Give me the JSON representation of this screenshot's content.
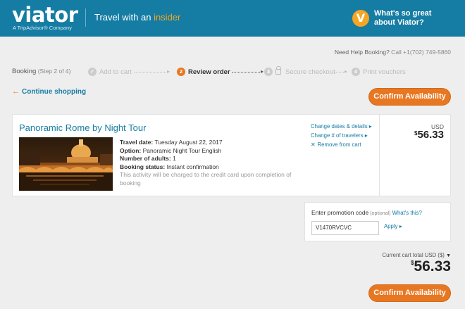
{
  "header": {
    "logo": "viator",
    "logo_sub": "A TripAdvisor® Company",
    "tagline_prefix": "Travel with an ",
    "tagline_accent": "insider",
    "badge": "V",
    "promo_line1": "What's so great",
    "promo_line2": "about Viator?"
  },
  "help": {
    "label": "Need Help Booking?",
    "phone": " Call +1(702) 749-5860"
  },
  "steps": {
    "title": "Booking",
    "title_small": " (Step 2 of 4)",
    "items": [
      {
        "num": "✓",
        "label": "Add to cart"
      },
      {
        "num": "2",
        "label": "Review order"
      },
      {
        "num": "3",
        "label": "Secure checkout"
      },
      {
        "num": "4",
        "label": "Print vouchers"
      }
    ]
  },
  "continue_label": "Continue shopping",
  "confirm_label": "Confirm Availability",
  "item": {
    "title": "Panoramic Rome by Night Tour",
    "travel_date_label": "Travel date:",
    "travel_date": " Tuesday August 22, 2017",
    "option_label": "Option:",
    "option": " Panoramic Night Tour English",
    "adults_label": "Number of adults:",
    "adults": " 1",
    "status_label": "Booking status:",
    "status": " Instant confirmation",
    "note": "This activity will be charged to the credit card upon completion of booking",
    "actions": {
      "change_dates": "Change dates & details",
      "change_travelers": "Change # of travelers",
      "remove": "Remove from cart"
    },
    "currency": "USD",
    "price_symbol": "$",
    "price": "56.33"
  },
  "promo": {
    "label": "Enter promotion code",
    "optional": " (optional)",
    "whats_this": " What's this?",
    "code": "V1470RVCVC",
    "apply": "Apply"
  },
  "totals": {
    "label": "Current cart total",
    "currency": " USD ($)",
    "symbol": "$",
    "value": "56.33"
  }
}
